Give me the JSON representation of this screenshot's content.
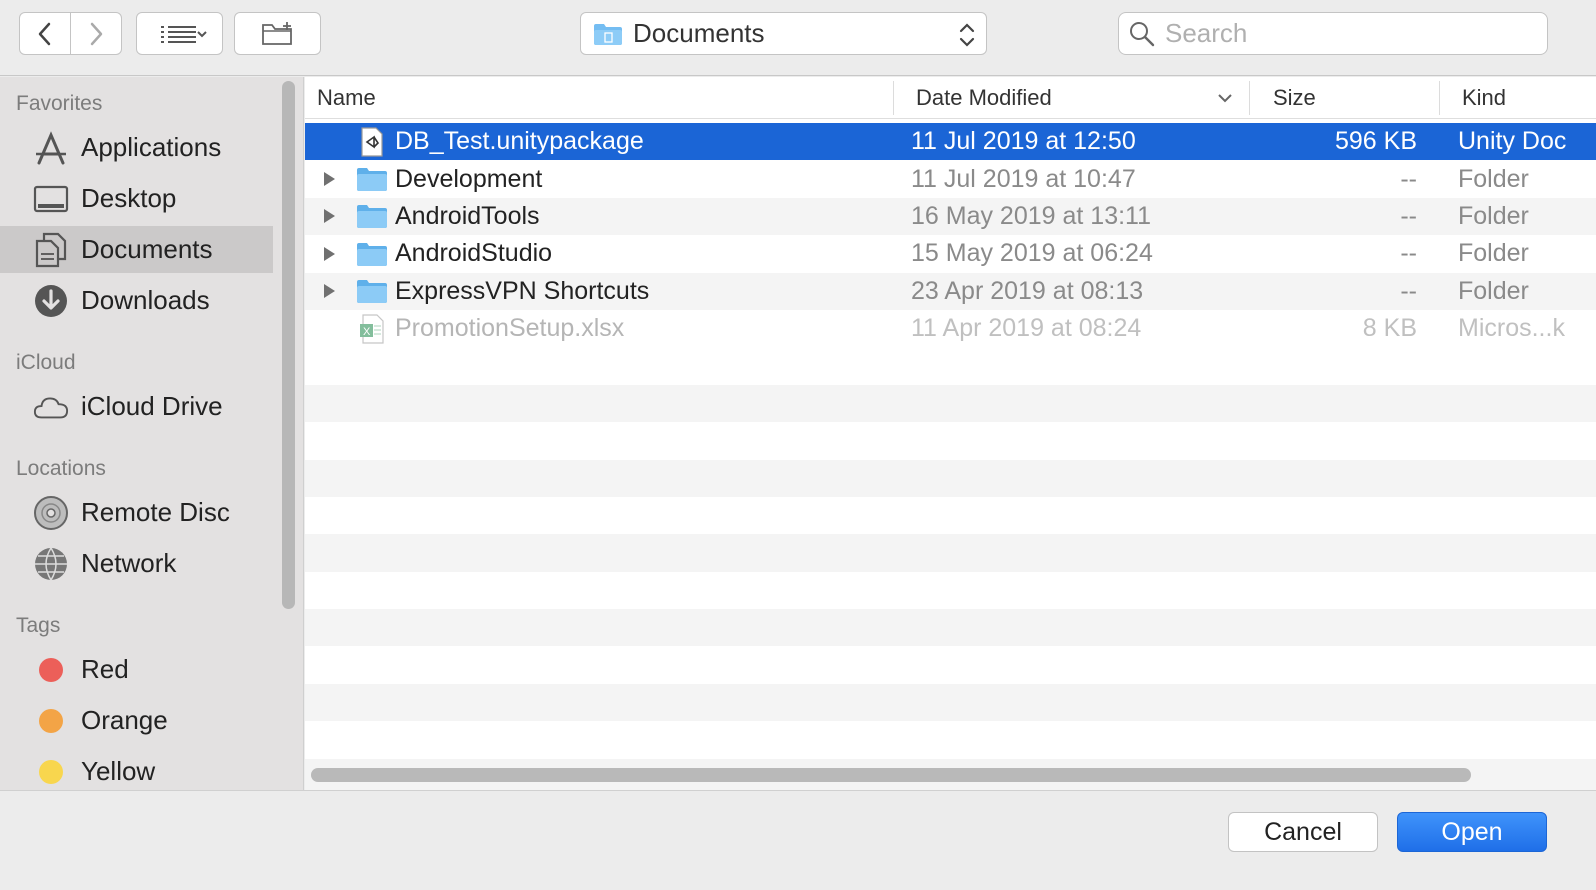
{
  "toolbar": {
    "location": "Documents",
    "search_placeholder": "Search"
  },
  "sidebar": {
    "sections": {
      "favorites": "Favorites",
      "icloud": "iCloud",
      "locations": "Locations",
      "tags": "Tags"
    },
    "favorites": [
      {
        "label": "Applications",
        "icon": "applications-icon"
      },
      {
        "label": "Desktop",
        "icon": "desktop-icon"
      },
      {
        "label": "Documents",
        "icon": "documents-icon",
        "selected": true
      },
      {
        "label": "Downloads",
        "icon": "downloads-icon"
      }
    ],
    "icloud": [
      {
        "label": "iCloud Drive",
        "icon": "cloud-icon"
      }
    ],
    "locations": [
      {
        "label": "Remote Disc",
        "icon": "disc-icon"
      },
      {
        "label": "Network",
        "icon": "network-icon"
      }
    ],
    "tags": [
      {
        "label": "Red",
        "color": "#ec5f59"
      },
      {
        "label": "Orange",
        "color": "#f3a446"
      },
      {
        "label": "Yellow",
        "color": "#f8d64e"
      }
    ]
  },
  "columns": {
    "name": "Name",
    "date": "Date Modified",
    "size": "Size",
    "kind": "Kind"
  },
  "files": [
    {
      "name": "DB_Test.unitypackage",
      "date": "11 Jul 2019 at 12:50",
      "size": "596 KB",
      "kind": "Unity Doc",
      "type": "unity",
      "selected": true
    },
    {
      "name": "Development",
      "date": "11 Jul 2019 at 10:47",
      "size": "--",
      "kind": "Folder",
      "type": "folder"
    },
    {
      "name": "AndroidTools",
      "date": "16 May 2019 at 13:11",
      "size": "--",
      "kind": "Folder",
      "type": "folder"
    },
    {
      "name": "AndroidStudio",
      "date": "15 May 2019 at 06:24",
      "size": "--",
      "kind": "Folder",
      "type": "folder"
    },
    {
      "name": "ExpressVPN Shortcuts",
      "date": "23 Apr 2019 at 08:13",
      "size": "--",
      "kind": "Folder",
      "type": "folder"
    },
    {
      "name": "PromotionSetup.xlsx",
      "date": "11 Apr 2019 at 08:24",
      "size": "8 KB",
      "kind": "Micros...k",
      "type": "excel",
      "disabled": true
    }
  ],
  "footer": {
    "cancel": "Cancel",
    "open": "Open"
  },
  "colors": {
    "selection": "#1b65d6",
    "open_button": "#2f7ff0",
    "folder": "#6ab8f0"
  }
}
